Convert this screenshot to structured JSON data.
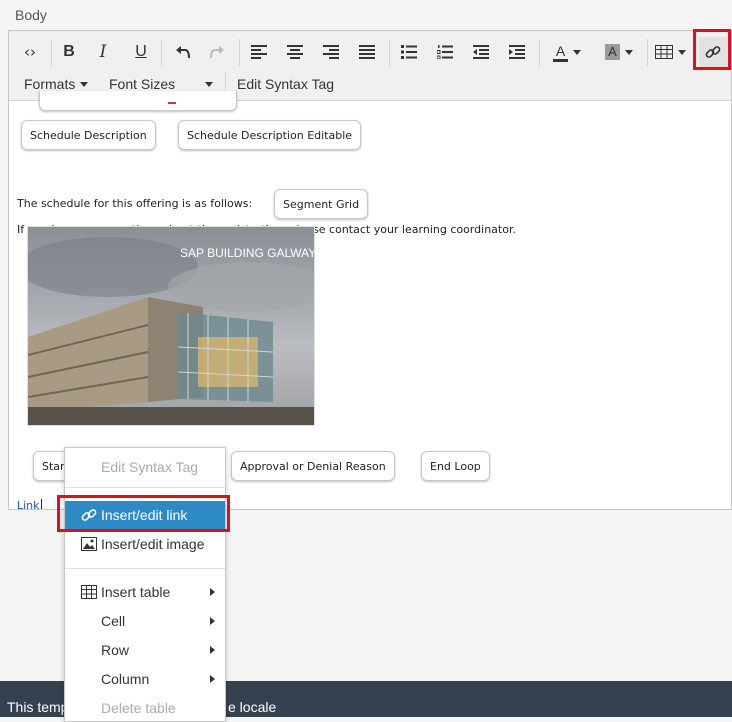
{
  "field": {
    "label": "Body"
  },
  "toolbar": {
    "buttons": [
      {
        "name": "source-code-icon",
        "glyph": "<>"
      },
      {
        "name": "bold-icon",
        "glyph": "B"
      },
      {
        "name": "italic-icon",
        "glyph": "I"
      },
      {
        "name": "underline-icon",
        "glyph": "U"
      },
      {
        "name": "undo-icon"
      },
      {
        "name": "redo-icon"
      },
      {
        "name": "align-left-icon"
      },
      {
        "name": "align-center-icon"
      },
      {
        "name": "align-right-icon"
      },
      {
        "name": "align-justify-icon"
      },
      {
        "name": "bullet-list-icon"
      },
      {
        "name": "numbered-list-icon"
      },
      {
        "name": "outdent-icon"
      },
      {
        "name": "indent-icon"
      },
      {
        "name": "text-color-icon",
        "glyph": "A"
      },
      {
        "name": "background-color-icon",
        "glyph": "A"
      },
      {
        "name": "table-icon"
      },
      {
        "name": "link-icon"
      }
    ],
    "menus": {
      "formats": "Formats",
      "font_sizes": "Font Sizes",
      "edit_syntax_tag": "Edit Syntax Tag"
    },
    "highlight_color": "#e0101a"
  },
  "content": {
    "chips": {
      "schedule_description": "Schedule Description",
      "schedule_description_editable": "Schedule Description Editable",
      "segment_grid": "Segment Grid",
      "start_partial": "Star",
      "approval_reason": "Approval or Denial Reason",
      "end_loop": "End Loop"
    },
    "schedule_text": "The schedule for this offering is as follows:",
    "questions_text": "If you have any questions about the registration, please contact your learning coordinator.",
    "image_caption": "SAP BUILDING GALWAY",
    "link_text": "Link"
  },
  "context_menu": {
    "edit_syntax_tag": "Edit Syntax Tag",
    "insert_edit_link": "Insert/edit link",
    "insert_edit_image": "Insert/edit image",
    "insert_table": "Insert table",
    "cell": "Cell",
    "row": "Row",
    "column": "Column",
    "delete_table": "Delete table",
    "active_color": "#2d8ac7"
  },
  "footer": {
    "text_left": "This temp",
    "text_right": "e locale"
  }
}
